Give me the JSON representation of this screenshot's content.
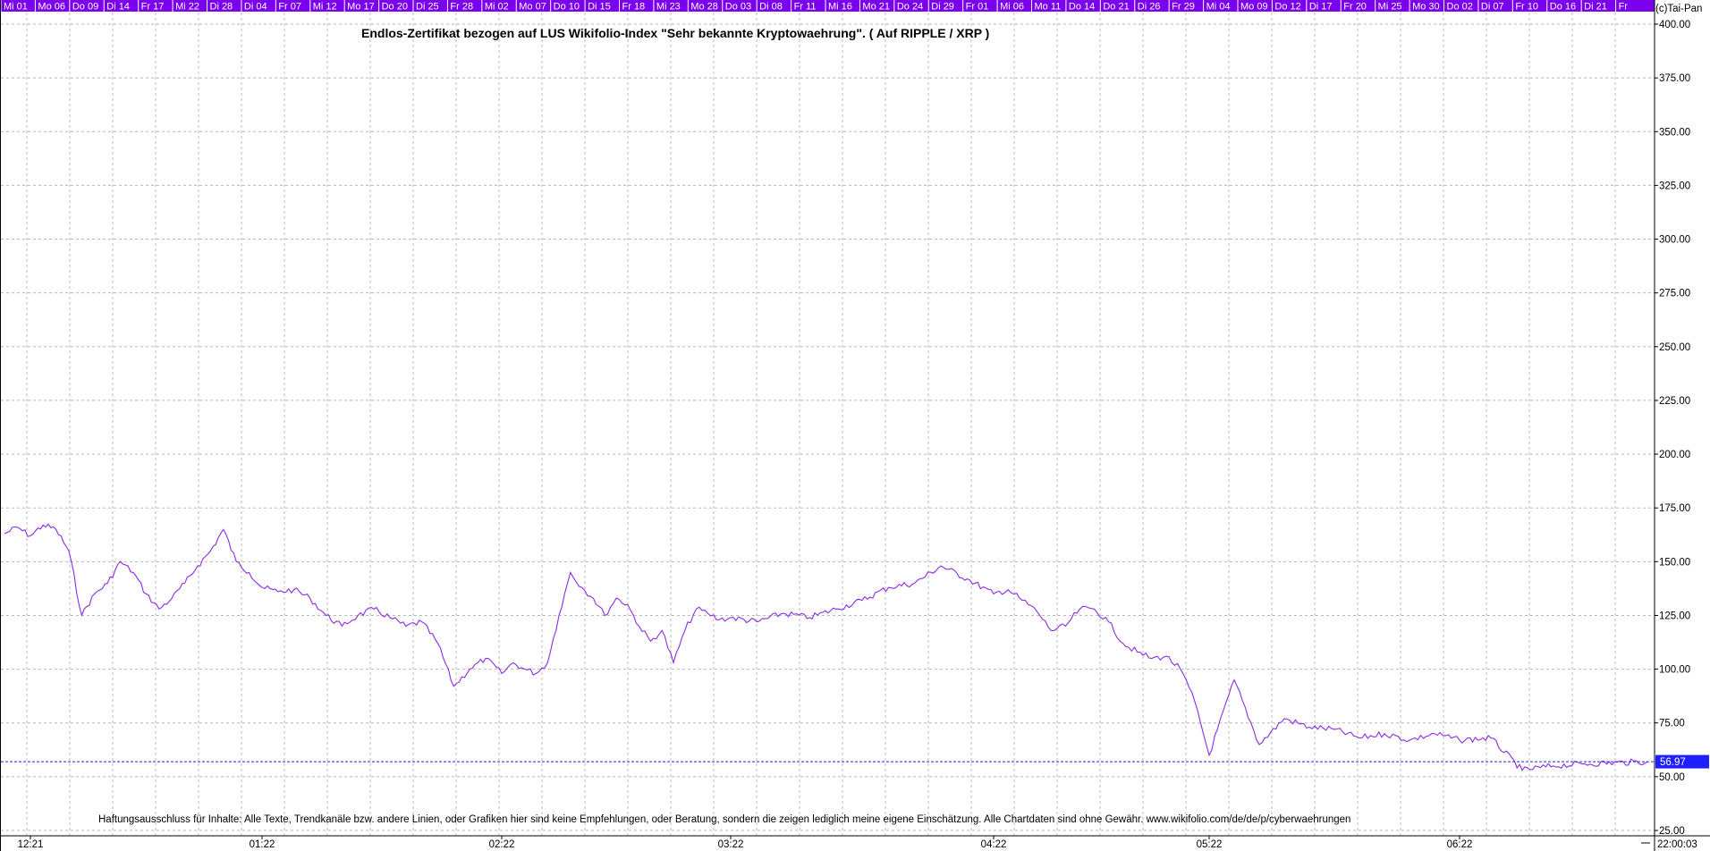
{
  "title": "Endlos-Zertifikat bezogen auf LUS Wikifolio-Index \"Sehr bekannte Kryptowaehrung\". ( Auf RIPPLE / XRP )",
  "copyright": "(c)Tai-Pan",
  "disclaimer": "Haftungsausschluss für Inhalte: Alle Texte, Trendkanäle bzw. andere Linien, oder Grafiken hier sind keine Empfehlungen, oder Beratung, sondern die zeigen lediglich meine eigene Einschätzung. Alle Chartdaten sind ohne Gewähr.  www.wikifolio.com/de/de/p/cyberwaehrungen",
  "last_price_label": "56.97",
  "clock": "22:00:03",
  "colors": {
    "date_strip": "#7b00ee",
    "line": "#8a2be2",
    "price_box": "#1f1fff",
    "grid": "#b8b8b8",
    "axis": "#000000"
  },
  "date_strip": [
    "Mi 01",
    "Mo 06",
    "Do 09",
    "Di 14",
    "Fr 17",
    "Mi 22",
    "Di 28",
    "Di 04",
    "Fr 07",
    "Mi 12",
    "Mo 17",
    "Do 20",
    "Di 25",
    "Fr 28",
    "Mi 02",
    "Mo 07",
    "Do 10",
    "Di 15",
    "Fr 18",
    "Mi 23",
    "Mo 28",
    "Do 03",
    "Di 08",
    "Fr 11",
    "Mi 16",
    "Mo 21",
    "Do 24",
    "Di 29",
    "Fr 01",
    "Mi 06",
    "Mo 11",
    "Do 14",
    "Do 21",
    "Di 26",
    "Fr 29",
    "Mi 04",
    "Mo 09",
    "Do 12",
    "Di 17",
    "Fr 20",
    "Mi 25",
    "Mo 30",
    "Do 02",
    "Di 07",
    "Fr 10",
    "Do 16",
    "Di 21",
    "Fr"
  ],
  "chart_data": {
    "type": "line",
    "title": "Endlos-Zertifikat bezogen auf LUS Wikifolio-Index \"Sehr bekannte Kryptowaehrung\". ( Auf RIPPLE / XRP )",
    "xlabel": "",
    "ylabel": "",
    "ylim": [
      25,
      400
    ],
    "grid": true,
    "y_ticks": [
      "25.00",
      "50.00",
      "75.00",
      "100.00",
      "125.00",
      "150.00",
      "175.00",
      "200.00",
      "225.00",
      "250.00",
      "275.00",
      "300.00",
      "325.00",
      "350.00",
      "375.00",
      "400.00"
    ],
    "x_ticks": [
      "12:21",
      "01:22",
      "02:22",
      "03:22",
      "04:22",
      "05:22",
      "06:22"
    ],
    "last_value": 56.97,
    "series": [
      {
        "points": [
          [
            "12:21",
            163
          ],
          [
            "12:21",
            166
          ],
          [
            "12:21",
            162
          ],
          [
            "12:21",
            167
          ],
          [
            "12:21",
            165
          ],
          [
            "12:21",
            155
          ],
          [
            "12:21",
            125
          ],
          [
            "12:21",
            135
          ],
          [
            "12:21",
            140
          ],
          [
            "12:21",
            150
          ],
          [
            "12:21",
            145
          ],
          [
            "12:21",
            135
          ],
          [
            "12:21",
            128
          ],
          [
            "12:21",
            133
          ],
          [
            "12:21",
            140
          ],
          [
            "12:21",
            148
          ],
          [
            "12:21",
            155
          ],
          [
            "12:21",
            165
          ],
          [
            "12:21",
            150
          ],
          [
            "12:21",
            145
          ],
          [
            "01:22",
            138
          ],
          [
            "01:22",
            136
          ],
          [
            "01:22",
            137
          ],
          [
            "01:22",
            133
          ],
          [
            "01:22",
            125
          ],
          [
            "01:22",
            120
          ],
          [
            "01:22",
            125
          ],
          [
            "01:22",
            128
          ],
          [
            "01:22",
            124
          ],
          [
            "01:22",
            120
          ],
          [
            "01:22",
            122
          ],
          [
            "01:22",
            112
          ],
          [
            "01:22",
            92
          ],
          [
            "01:22",
            100
          ],
          [
            "01:22",
            105
          ],
          [
            "02:22",
            98
          ],
          [
            "02:22",
            103
          ],
          [
            "02:22",
            100
          ],
          [
            "02:22",
            98
          ],
          [
            "02:22",
            103
          ],
          [
            "02:22",
            125
          ],
          [
            "02:22",
            145
          ],
          [
            "02:22",
            138
          ],
          [
            "02:22",
            133
          ],
          [
            "02:22",
            125
          ],
          [
            "02:22",
            133
          ],
          [
            "02:22",
            130
          ],
          [
            "02:22",
            120
          ],
          [
            "02:22",
            113
          ],
          [
            "02:22",
            118
          ],
          [
            "02:22",
            103
          ],
          [
            "02:22",
            118
          ],
          [
            "02:22",
            128
          ],
          [
            "02:22",
            126
          ],
          [
            "02:22",
            123
          ],
          [
            "03:22",
            124
          ],
          [
            "03:22",
            122
          ],
          [
            "03:22",
            126
          ],
          [
            "03:22",
            124
          ],
          [
            "03:22",
            128
          ],
          [
            "03:22",
            132
          ],
          [
            "03:22",
            138
          ],
          [
            "03:22",
            140
          ],
          [
            "03:22",
            148
          ],
          [
            "03:22",
            142
          ],
          [
            "04:22",
            135
          ],
          [
            "04:22",
            137
          ],
          [
            "04:22",
            132
          ],
          [
            "04:22",
            127
          ],
          [
            "04:22",
            118
          ],
          [
            "04:22",
            120
          ],
          [
            "04:22",
            128
          ],
          [
            "04:22",
            128
          ],
          [
            "04:22",
            122
          ],
          [
            "04:22",
            112
          ],
          [
            "04:22",
            108
          ],
          [
            "04:22",
            105
          ],
          [
            "04:22",
            106
          ],
          [
            "04:22",
            100
          ],
          [
            "04:22",
            85
          ],
          [
            "05:22",
            60
          ],
          [
            "05:22",
            95
          ],
          [
            "05:22",
            65
          ],
          [
            "05:22",
            77
          ],
          [
            "05:22",
            73
          ],
          [
            "05:22",
            72
          ],
          [
            "05:22",
            68
          ],
          [
            "05:22",
            70
          ],
          [
            "05:22",
            67
          ],
          [
            "05:22",
            70
          ],
          [
            "06:22",
            67
          ],
          [
            "06:22",
            68
          ],
          [
            "06:22",
            53
          ],
          [
            "06:22",
            55
          ],
          [
            "06:22",
            56
          ],
          [
            "06:22",
            57
          ]
        ]
      }
    ]
  }
}
